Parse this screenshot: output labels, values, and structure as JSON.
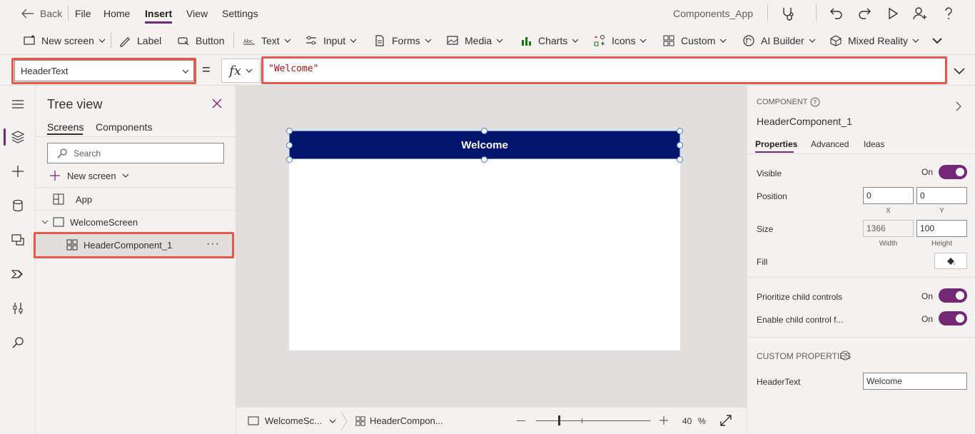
{
  "menubar": {
    "back": "Back",
    "items": [
      "File",
      "Home",
      "Insert",
      "View",
      "Settings"
    ],
    "app_name": "Components_App"
  },
  "ribbon": {
    "new_screen": "New screen",
    "label": "Label",
    "button": "Button",
    "text": "Text",
    "input": "Input",
    "forms": "Forms",
    "media": "Media",
    "charts": "Charts",
    "icons": "Icons",
    "custom": "Custom",
    "ai_builder": "AI Builder",
    "mixed_reality": "Mixed Reality"
  },
  "formula": {
    "property": "HeaderText",
    "equals": "=",
    "fx": "fx",
    "value": "\"Welcome\""
  },
  "tree": {
    "title": "Tree view",
    "tabs": [
      "Screens",
      "Components"
    ],
    "search_placeholder": "Search",
    "new_screen": "New screen",
    "app": "App",
    "screen": "WelcomeScreen",
    "component": "HeaderComponent_1",
    "more": "···"
  },
  "canvas": {
    "header_text": "Welcome"
  },
  "status": {
    "screen_crumb": "WelcomeSc...",
    "component_crumb": "HeaderCompon...",
    "zoom": "40",
    "zoom_unit": "%",
    "zoom_fraction": 0.4
  },
  "props": {
    "kind": "COMPONENT",
    "name": "HeaderComponent_1",
    "tabs": [
      "Properties",
      "Advanced",
      "Ideas"
    ],
    "visible_label": "Visible",
    "on": "On",
    "position_label": "Position",
    "x": "0",
    "y": "0",
    "x_caption": "X",
    "y_caption": "Y",
    "size_label": "Size",
    "width": "1366",
    "height": "100",
    "width_caption": "Width",
    "height_caption": "Height",
    "fill_label": "Fill",
    "prioritize_label": "Prioritize child controls",
    "enable_label": "Enable child control f...",
    "custom_header": "CUSTOM PROPERTIES",
    "header_text_label": "HeaderText",
    "header_text_value": "Welcome"
  },
  "colors": {
    "accent": "#742774",
    "header_fill": "#00156b",
    "highlight": "#e8574b"
  }
}
